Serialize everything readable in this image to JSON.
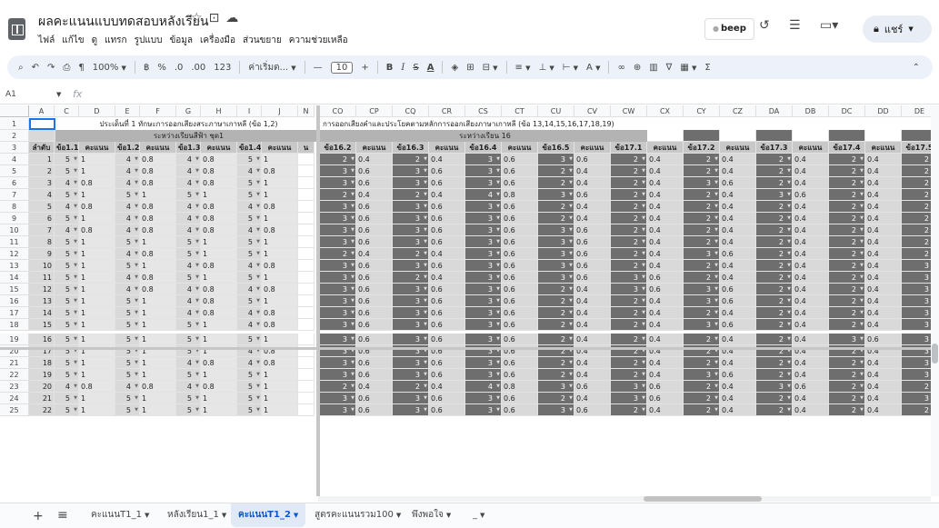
{
  "title_bar": {
    "title": "ผลคะแนนแบบทดสอบหลังเรียน",
    "menu": [
      "ไฟล์",
      "แก้ไข",
      "ดู",
      "แทรก",
      "รูปแบบ",
      "ข้อมูล",
      "เครื่องมือ",
      "ส่วนขยาย",
      "ความช่วยเหลือ"
    ],
    "beep_label": "beep",
    "share_label": "แชร์"
  },
  "toolbar": {
    "zoom": "100%",
    "currency": "฿",
    "percent": "%",
    "dec_decrease": ".0",
    "dec_increase": ".00",
    "number_format": "123",
    "font": "ค่าเริ่มต...",
    "font_size": "10",
    "minus": "—",
    "plus": "+",
    "bold": "B",
    "italic": "I",
    "strike": "S",
    "text_color": "A",
    "sigma": "Σ"
  },
  "formula_bar": {
    "cell_ref": "A1",
    "fx": "fx"
  },
  "left_columns": [
    "A",
    "C",
    "D",
    "E",
    "F",
    "G",
    "H",
    "I",
    "J",
    "N"
  ],
  "right_columns": [
    "CO",
    "CP",
    "CQ",
    "CR",
    "CS",
    "CT",
    "CU",
    "CV",
    "CW",
    "CX",
    "CY",
    "CZ",
    "DA",
    "DB",
    "DC",
    "DD",
    "DE"
  ],
  "row_numbers": [
    1,
    2,
    3,
    4,
    5,
    6,
    7,
    8,
    9,
    10,
    11,
    12,
    13,
    14,
    15,
    16,
    17,
    18,
    19,
    20,
    21,
    22,
    23,
    24,
    25
  ],
  "banner_left_1": "ประเด็นที่ 1 ทักษะการออกเสียงสระภาษาเกาหลี (ข้อ 1,2)",
  "banner_left_2": "ระหว่างเรียนสีฟ้า ชุด1",
  "banner_right_1": "การออกเสียงคำและประโยคตามหลักการออกเสียงภาษาเกาหลี (ข้อ 13,14,15,16,17,18,19)",
  "banner_right_2": "ระหว่างเรียน 16",
  "left_headers": [
    "ลำดับ",
    "ข้อ1.1",
    "คะแนน",
    "ข้อ1.2",
    "คะแนน",
    "ข้อ1.3",
    "คะแนน",
    "ข้อ1.4",
    "คะแนน",
    "น"
  ],
  "right_headers": [
    "ข้อ16.2",
    "คะแนน",
    "ข้อ16.3",
    "คะแนน",
    "ข้อ16.4",
    "คะแนน",
    "ข้อ16.5",
    "คะแนน",
    "ข้อ17.1",
    "คะแนน",
    "ข้อ17.2",
    "คะแนน",
    "ข้อ17.3",
    "คะแนน",
    "ข้อ17.4",
    "คะแนน",
    "ข้อ17.5"
  ],
  "left_rows": [
    [
      "1",
      "5",
      "1",
      "4",
      "0.8",
      "4",
      "0.8",
      "5",
      "1"
    ],
    [
      "2",
      "5",
      "1",
      "4",
      "0.8",
      "4",
      "0.8",
      "4",
      "0.8"
    ],
    [
      "3",
      "4",
      "0.8",
      "4",
      "0.8",
      "4",
      "0.8",
      "5",
      "1"
    ],
    [
      "4",
      "5",
      "1",
      "5",
      "1",
      "5",
      "1",
      "5",
      "1"
    ],
    [
      "5",
      "4",
      "0.8",
      "4",
      "0.8",
      "4",
      "0.8",
      "4",
      "0.8"
    ],
    [
      "6",
      "5",
      "1",
      "4",
      "0.8",
      "4",
      "0.8",
      "5",
      "1"
    ],
    [
      "7",
      "4",
      "0.8",
      "4",
      "0.8",
      "4",
      "0.8",
      "4",
      "0.8"
    ],
    [
      "8",
      "5",
      "1",
      "5",
      "1",
      "5",
      "1",
      "5",
      "1"
    ],
    [
      "9",
      "5",
      "1",
      "4",
      "0.8",
      "5",
      "1",
      "5",
      "1"
    ],
    [
      "10",
      "5",
      "1",
      "5",
      "1",
      "4",
      "0.8",
      "4",
      "0.8"
    ],
    [
      "11",
      "5",
      "1",
      "4",
      "0.8",
      "5",
      "1",
      "5",
      "1"
    ],
    [
      "12",
      "5",
      "1",
      "4",
      "0.8",
      "4",
      "0.8",
      "4",
      "0.8"
    ],
    [
      "13",
      "5",
      "1",
      "5",
      "1",
      "4",
      "0.8",
      "5",
      "1"
    ],
    [
      "14",
      "5",
      "1",
      "5",
      "1",
      "4",
      "0.8",
      "4",
      "0.8"
    ],
    [
      "15",
      "5",
      "1",
      "5",
      "1",
      "5",
      "1",
      "4",
      "0.8"
    ],
    [
      "16",
      "5",
      "1",
      "5",
      "1",
      "5",
      "1",
      "5",
      "1"
    ],
    [
      "17",
      "5",
      "1",
      "5",
      "1",
      "5",
      "1",
      "4",
      "0.8"
    ],
    [
      "18",
      "5",
      "1",
      "5",
      "1",
      "4",
      "0.8",
      "4",
      "0.8"
    ],
    [
      "19",
      "5",
      "1",
      "5",
      "1",
      "5",
      "1",
      "5",
      "1"
    ],
    [
      "20",
      "4",
      "0.8",
      "4",
      "0.8",
      "4",
      "0.8",
      "5",
      "1"
    ],
    [
      "21",
      "5",
      "1",
      "5",
      "1",
      "5",
      "1",
      "5",
      "1"
    ],
    [
      "22",
      "5",
      "1",
      "5",
      "1",
      "5",
      "1",
      "5",
      "1"
    ]
  ],
  "right_rows": [
    [
      "2",
      "0.4",
      "2",
      "0.4",
      "3",
      "0.6",
      "3",
      "0.6",
      "2",
      "0.4",
      "2",
      "0.4",
      "2",
      "0.4",
      "2",
      "0.4",
      "2"
    ],
    [
      "3",
      "0.6",
      "3",
      "0.6",
      "3",
      "0.6",
      "2",
      "0.4",
      "2",
      "0.4",
      "2",
      "0.4",
      "2",
      "0.4",
      "2",
      "0.4",
      "2"
    ],
    [
      "3",
      "0.6",
      "3",
      "0.6",
      "3",
      "0.6",
      "2",
      "0.4",
      "2",
      "0.4",
      "3",
      "0.6",
      "2",
      "0.4",
      "2",
      "0.4",
      "2"
    ],
    [
      "2",
      "0.4",
      "2",
      "0.4",
      "4",
      "0.8",
      "3",
      "0.6",
      "2",
      "0.4",
      "2",
      "0.4",
      "3",
      "0.6",
      "2",
      "0.4",
      "2"
    ],
    [
      "3",
      "0.6",
      "3",
      "0.6",
      "3",
      "0.6",
      "2",
      "0.4",
      "2",
      "0.4",
      "2",
      "0.4",
      "2",
      "0.4",
      "2",
      "0.4",
      "2"
    ],
    [
      "3",
      "0.6",
      "3",
      "0.6",
      "3",
      "0.6",
      "2",
      "0.4",
      "2",
      "0.4",
      "2",
      "0.4",
      "2",
      "0.4",
      "2",
      "0.4",
      "2"
    ],
    [
      "3",
      "0.6",
      "3",
      "0.6",
      "3",
      "0.6",
      "3",
      "0.6",
      "2",
      "0.4",
      "2",
      "0.4",
      "2",
      "0.4",
      "2",
      "0.4",
      "2"
    ],
    [
      "3",
      "0.6",
      "3",
      "0.6",
      "3",
      "0.6",
      "3",
      "0.6",
      "2",
      "0.4",
      "2",
      "0.4",
      "2",
      "0.4",
      "2",
      "0.4",
      "2"
    ],
    [
      "2",
      "0.4",
      "2",
      "0.4",
      "3",
      "0.6",
      "3",
      "0.6",
      "2",
      "0.4",
      "3",
      "0.6",
      "2",
      "0.4",
      "2",
      "0.4",
      "2"
    ],
    [
      "3",
      "0.6",
      "3",
      "0.6",
      "3",
      "0.6",
      "3",
      "0.6",
      "2",
      "0.4",
      "2",
      "0.4",
      "2",
      "0.4",
      "2",
      "0.4",
      "3"
    ],
    [
      "3",
      "0.6",
      "2",
      "0.4",
      "3",
      "0.6",
      "3",
      "0.6",
      "3",
      "0.6",
      "2",
      "0.4",
      "2",
      "0.4",
      "2",
      "0.4",
      "3"
    ],
    [
      "3",
      "0.6",
      "3",
      "0.6",
      "3",
      "0.6",
      "2",
      "0.4",
      "3",
      "0.6",
      "3",
      "0.6",
      "2",
      "0.4",
      "2",
      "0.4",
      "3"
    ],
    [
      "3",
      "0.6",
      "3",
      "0.6",
      "3",
      "0.6",
      "2",
      "0.4",
      "2",
      "0.4",
      "3",
      "0.6",
      "2",
      "0.4",
      "2",
      "0.4",
      "3"
    ],
    [
      "3",
      "0.6",
      "3",
      "0.6",
      "3",
      "0.6",
      "2",
      "0.4",
      "2",
      "0.4",
      "2",
      "0.4",
      "2",
      "0.4",
      "2",
      "0.4",
      "3"
    ],
    [
      "3",
      "0.6",
      "3",
      "0.6",
      "3",
      "0.6",
      "2",
      "0.4",
      "2",
      "0.4",
      "3",
      "0.6",
      "2",
      "0.4",
      "2",
      "0.4",
      "3"
    ],
    [
      "3",
      "0.6",
      "3",
      "0.6",
      "3",
      "0.6",
      "2",
      "0.4",
      "2",
      "0.4",
      "2",
      "0.4",
      "2",
      "0.4",
      "3",
      "0.6",
      "3"
    ],
    [
      "3",
      "0.6",
      "3",
      "0.6",
      "3",
      "0.6",
      "2",
      "0.4",
      "2",
      "0.4",
      "2",
      "0.4",
      "2",
      "0.4",
      "2",
      "0.4",
      "3"
    ],
    [
      "3",
      "0.6",
      "3",
      "0.6",
      "3",
      "0.6",
      "2",
      "0.4",
      "2",
      "0.4",
      "2",
      "0.4",
      "2",
      "0.4",
      "2",
      "0.4",
      "3"
    ],
    [
      "3",
      "0.6",
      "3",
      "0.6",
      "3",
      "0.6",
      "2",
      "0.4",
      "2",
      "0.4",
      "3",
      "0.6",
      "2",
      "0.4",
      "2",
      "0.4",
      "3"
    ],
    [
      "2",
      "0.4",
      "2",
      "0.4",
      "4",
      "0.8",
      "3",
      "0.6",
      "3",
      "0.6",
      "2",
      "0.4",
      "3",
      "0.6",
      "2",
      "0.4",
      "2"
    ],
    [
      "3",
      "0.6",
      "3",
      "0.6",
      "3",
      "0.6",
      "2",
      "0.4",
      "3",
      "0.6",
      "2",
      "0.4",
      "2",
      "0.4",
      "2",
      "0.4",
      "3"
    ],
    [
      "3",
      "0.6",
      "3",
      "0.6",
      "3",
      "0.6",
      "3",
      "0.6",
      "2",
      "0.4",
      "2",
      "0.4",
      "2",
      "0.4",
      "2",
      "0.4",
      "2"
    ]
  ],
  "sheet_tabs": [
    {
      "label": "คะแนนT1_1",
      "active": false
    },
    {
      "label": "หลังเรียน1_1",
      "active": false
    },
    {
      "label": "คะแนนT1_2",
      "active": true
    },
    {
      "label": "สูตรคะแนนรวม100",
      "active": false
    },
    {
      "label": "พึงพอใจ",
      "active": false
    },
    {
      "label": "_",
      "active": false
    }
  ],
  "colors": {
    "accent": "#1a73e8",
    "dark_column": "#6e6e6e",
    "header_gray": "#c8c8c8",
    "light_column": "#d9d9d9",
    "active_tab": "#0b57d0"
  }
}
